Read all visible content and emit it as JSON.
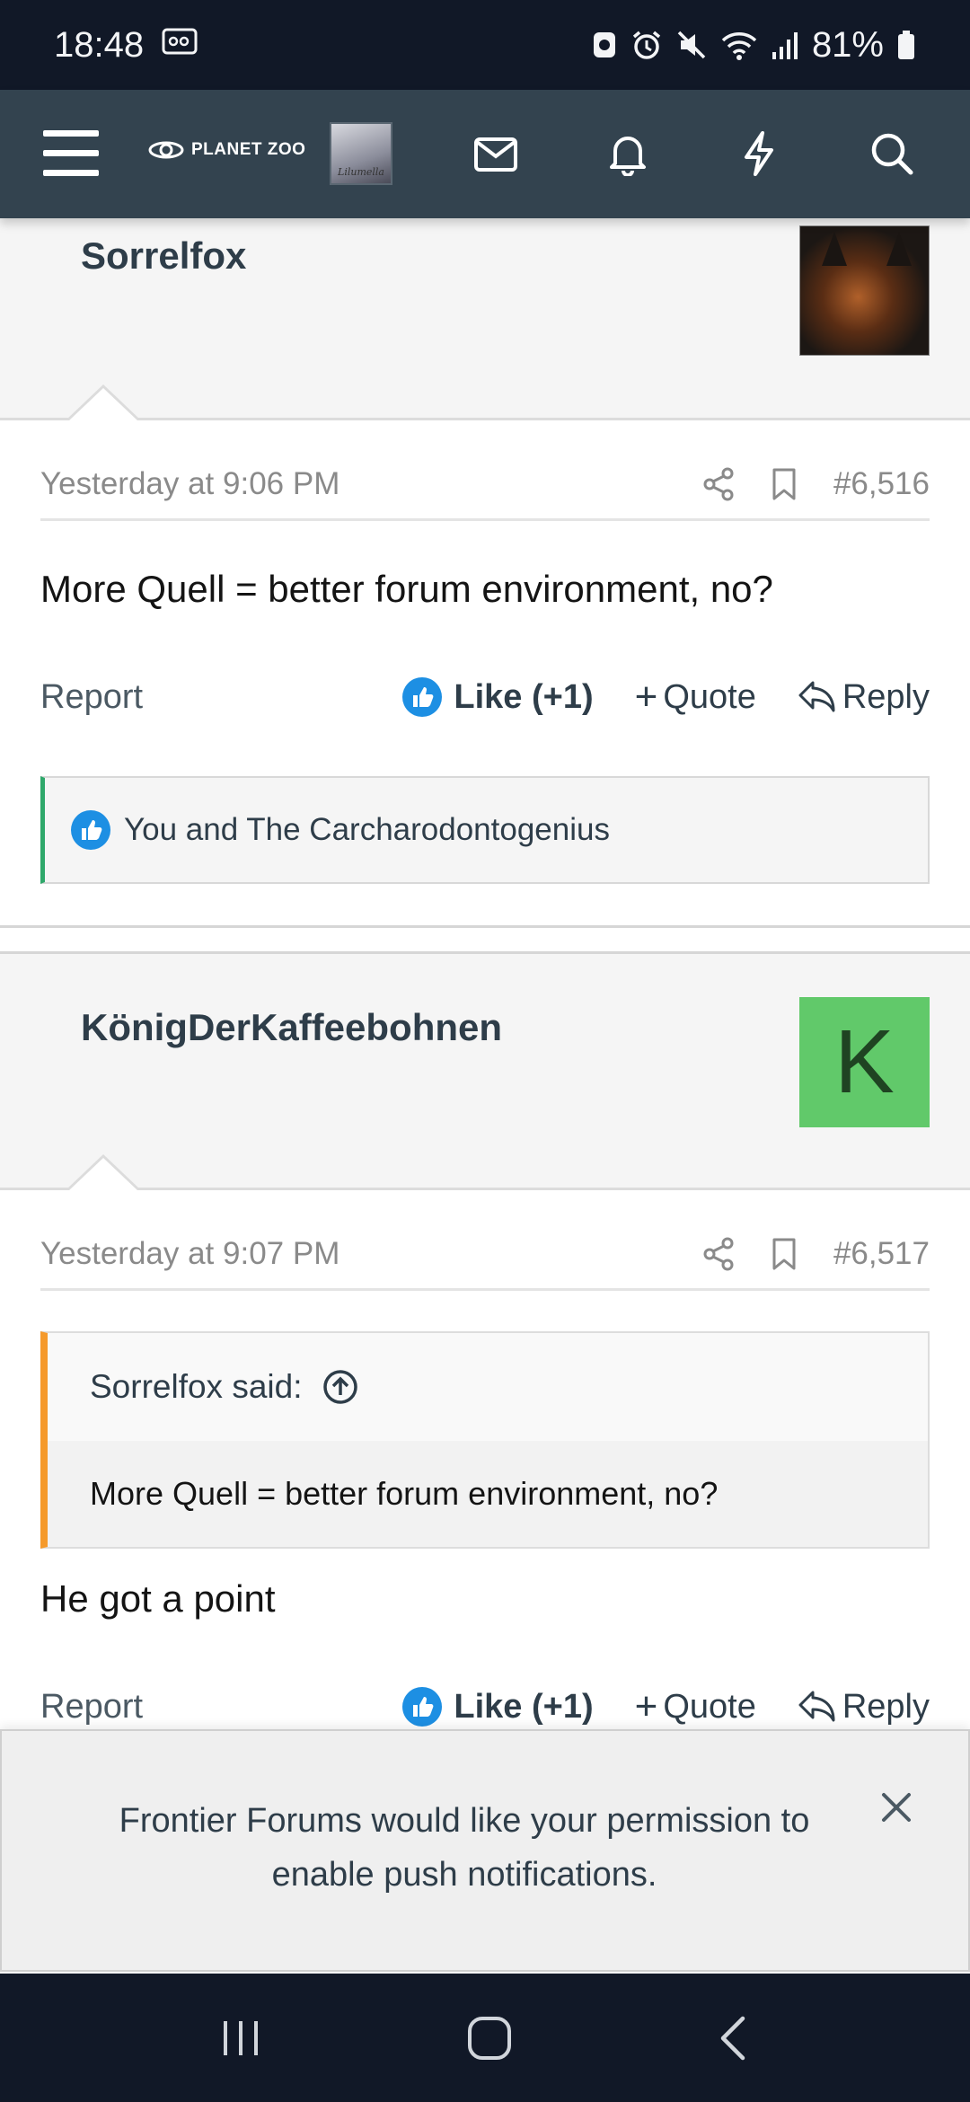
{
  "status_bar": {
    "time": "18:48",
    "battery_text": "81%",
    "icons": [
      "cast-icon",
      "bixby-icon",
      "alarm-icon",
      "mute-icon",
      "wifi-icon",
      "signal-icon",
      "battery-icon"
    ]
  },
  "header": {
    "brand": "PLANET ZOO",
    "avatar_caption": "Lilumella",
    "icons": [
      "menu-icon",
      "inbox-icon",
      "bell-icon",
      "bolt-icon",
      "search-icon"
    ]
  },
  "posts": [
    {
      "username": "Sorrelfox",
      "avatar": "fox-photo",
      "date": "Yesterday at 9:06 PM",
      "post_number": "#6,516",
      "body": "More Quell = better forum environment, no?",
      "actions": {
        "report": "Report",
        "like": "Like (+1)",
        "quote": "Quote",
        "reply": "Reply"
      },
      "reactions": "You and The Carcharodontogenius"
    },
    {
      "username": "KönigDerKaffeebohnen",
      "avatar_letter": "K",
      "date": "Yesterday at 9:07 PM",
      "post_number": "#6,517",
      "quote": {
        "author": "Sorrelfox said:",
        "text": "More Quell = better forum environment, no?"
      },
      "body": "He got a point",
      "actions": {
        "report": "Report",
        "like": "Like (+1)",
        "quote": "Quote",
        "reply": "Reply"
      }
    }
  ],
  "push_banner": {
    "message": "Frontier Forums would like your permission to enable push notifications."
  },
  "colors": {
    "header_bg": "#33434f",
    "accent_like": "#1d8fe3",
    "reaction_border": "#2fa86b",
    "quote_border": "#f59a2b",
    "avatar_k_bg": "#61c96a"
  }
}
